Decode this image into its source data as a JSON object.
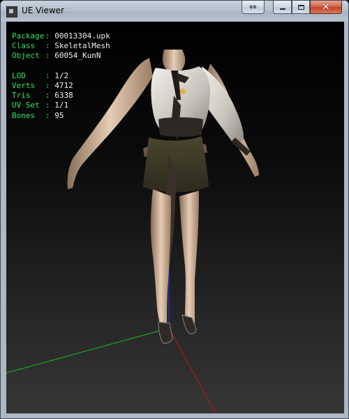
{
  "window": {
    "title": "UE Viewer",
    "buttons": {
      "swap": "⇔",
      "minimize": "",
      "maximize": "",
      "close": "✕"
    }
  },
  "info": {
    "package": {
      "label": "Package",
      "value": "00013304.upk"
    },
    "class": {
      "label": "Class",
      "value": "SkeletalMesh"
    },
    "object": {
      "label": "Object",
      "value": "60054_KunN"
    },
    "lod": {
      "label": "LOD",
      "value": "1/2"
    },
    "verts": {
      "label": "Verts",
      "value": "4712"
    },
    "tris": {
      "label": "Tris",
      "value": "6338"
    },
    "uvset": {
      "label": "UV Set",
      "value": "1/1"
    },
    "bones": {
      "label": "Bones",
      "value": "95"
    }
  },
  "colors": {
    "label_green": "#34e55d",
    "value_white": "#f0f0f0",
    "axis_x": "#b31414",
    "axis_y": "#1aa51a",
    "axis_z": "#2230b5"
  }
}
